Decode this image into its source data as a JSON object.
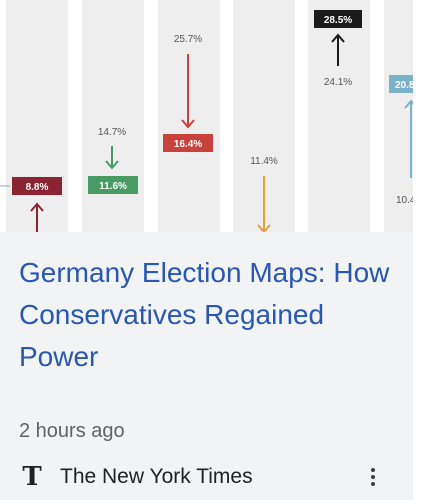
{
  "card": {
    "headline": "Germany Election Maps: How Conservatives Regained Power",
    "time": "2 hours ago",
    "source": "The New York Times",
    "source_logo_letter": "T",
    "more_icon": "more-vert-icon"
  },
  "thumbnail": {
    "labels": [
      {
        "id": "red-dark",
        "text": "8.8%"
      },
      {
        "id": "green-from",
        "text": "14.7%"
      },
      {
        "id": "green-to",
        "text": "11.6%"
      },
      {
        "id": "red-from",
        "text": "25.7%"
      },
      {
        "id": "red-to",
        "text": "16.4%"
      },
      {
        "id": "orange-from",
        "text": "11.4%"
      },
      {
        "id": "black-to",
        "text": "28.5%"
      },
      {
        "id": "black-from",
        "text": "24.1%"
      },
      {
        "id": "blue-to",
        "text": "20.8"
      },
      {
        "id": "blue-from",
        "text": "10.4"
      }
    ],
    "colors": {
      "column_bg": "#eeeeee",
      "dark_red": "#8b2332",
      "green": "#4a9a63",
      "red": "#c8413b",
      "orange": "#e0a043",
      "black": "#1b1b1b",
      "light_blue": "#7ab2c9"
    }
  }
}
